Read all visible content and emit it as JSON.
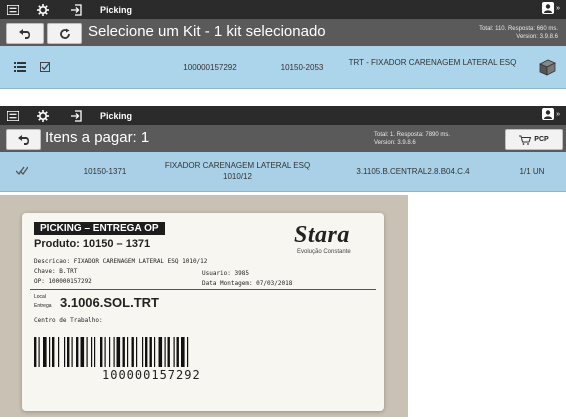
{
  "screen1": {
    "topbar": {
      "title": "Picking",
      "menu_icon": "menu-icon",
      "settings_icon": "gear-icon",
      "exit_icon": "exit-icon",
      "user_icon": "user-icon",
      "more": "»"
    },
    "subbar": {
      "title": "Selecione um Kit - 1 kit selecionado",
      "status_line1": "Total: 110. Resposta: 660 ms.",
      "status_line2": "Version: 3.9.8.6"
    },
    "row": {
      "op": "100000157292",
      "code": "10150-2053",
      "description": "TRT - FIXADOR CARENAGEM LATERAL ESQ"
    }
  },
  "screen2": {
    "topbar": {
      "title": "Picking",
      "more": "»"
    },
    "subbar": {
      "title": "Itens a pagar: 1",
      "status_line1": "Total: 1. Resposta: 7890 ms.",
      "status_line2": "Version: 3.9.8.6",
      "pcp_label": "PCP"
    },
    "row": {
      "code": "10150-1371",
      "description": "FIXADOR CARENAGEM LATERAL ESQ 1010/12",
      "location": "3.1105.B.CENTRAL2.8.B04.C.4",
      "quantity": "1/1 UN"
    }
  },
  "label": {
    "header": "PICKING – ENTREGA OP",
    "product": "Produto: 10150 – 1371",
    "brand": "Stara",
    "brand_tagline": "Evolução Constante",
    "description": "Descricao: FIXADOR CARENAGEM LATERAL ESQ 1010/12",
    "key": "Chave: B.TRT",
    "user": "Usuario: 3985",
    "op": "OP: 100000157292",
    "mount_date": "Data Montagem: 07/03/2018",
    "local_label_1": "Local",
    "local_label_2": "Entrega",
    "local_value": "3.1006.SOL.TRT",
    "work_center": "Centro de Trabalho:",
    "barcode_value": "100000157292"
  }
}
